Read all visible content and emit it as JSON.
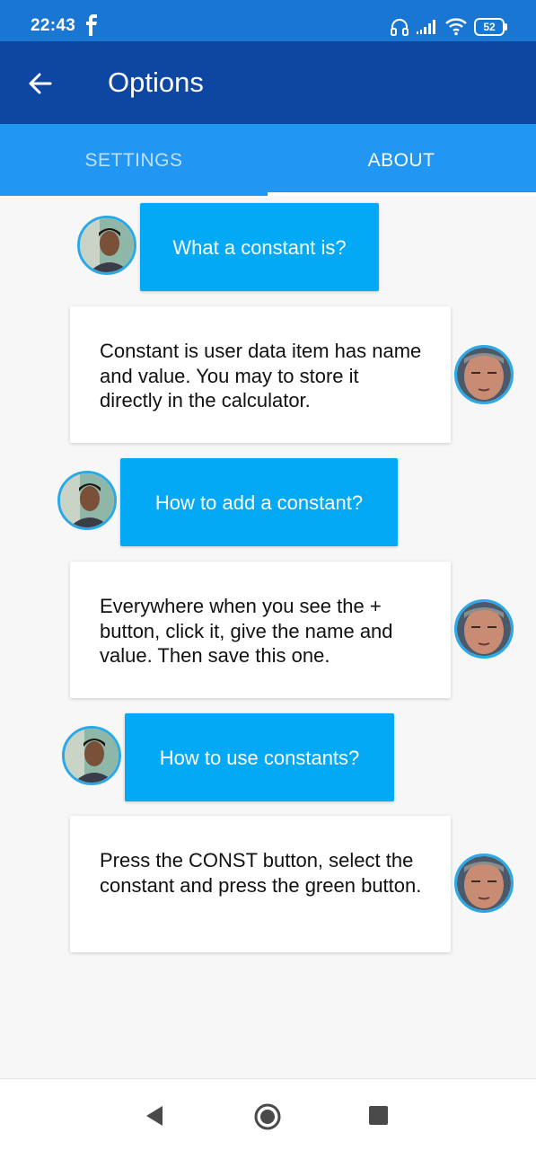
{
  "status_bar": {
    "time": "22:43",
    "battery": "52",
    "icons": [
      "facebook-icon",
      "headset-icon",
      "signal-icon",
      "wifi-icon",
      "battery-icon"
    ]
  },
  "app_bar": {
    "title": "Options",
    "back_icon": "arrow-left-icon"
  },
  "tabs": [
    {
      "label": "SETTINGS",
      "selected": false
    },
    {
      "label": "ABOUT",
      "selected": true
    }
  ],
  "faq": [
    {
      "question": "What a constant is?",
      "answer": "Constant is user data item has name and value. You may to store it directly in the calculator."
    },
    {
      "question": "How to add a constant?",
      "answer": "Everywhere when you see the + button, click it, give the name and value. Then save this one."
    },
    {
      "question": "How to use constants?",
      "answer": "Press the CONST button, select the constant and press the green button."
    }
  ],
  "nav_bar": {
    "icons": [
      "nav-back-icon",
      "nav-home-icon",
      "nav-recents-icon"
    ]
  },
  "colors": {
    "status_bar": "#1976d2",
    "app_bar": "#0d47a1",
    "tab_bar": "#2196f3",
    "question_bubble": "#03a9f4",
    "avatar_border": "#29a9e8"
  }
}
